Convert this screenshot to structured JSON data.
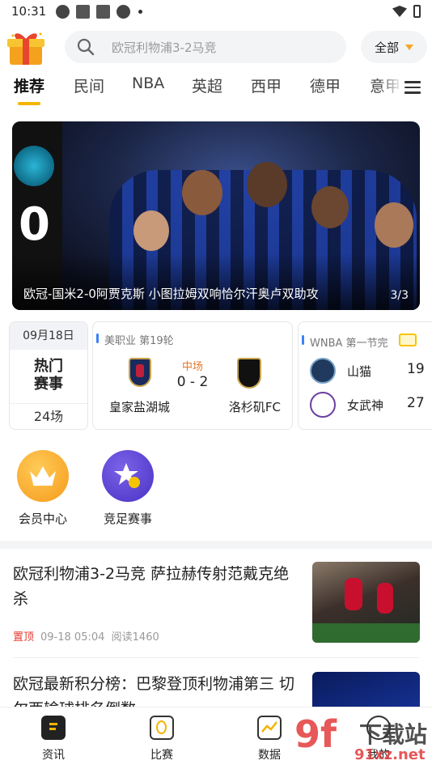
{
  "status_bar": {
    "time": "10:31"
  },
  "header": {
    "search_placeholder": "欧冠利物浦3-2马竞",
    "filter_label": "全部"
  },
  "tabs": [
    "推荐",
    "民间",
    "NBA",
    "英超",
    "西甲",
    "德甲",
    "意甲"
  ],
  "banner": {
    "caption": "欧冠-国米2-0阿贾克斯 小图拉姆双响恰尔汗奥卢双助攻",
    "counter": "3/3",
    "score_fragment": "0"
  },
  "hot_card": {
    "date": "09月18日",
    "line1": "热门",
    "line2": "赛事",
    "count": "24场"
  },
  "match_card": {
    "league": "美职业 第19轮",
    "status": "中场",
    "score": "0 - 2",
    "home": "皇家盐湖城",
    "away": "洛杉矶FC"
  },
  "wnba_card": {
    "league": "WNBA 第一节完",
    "team1": {
      "name": "山猫",
      "score": "19"
    },
    "team2": {
      "name": "女武神",
      "score": "27"
    }
  },
  "quick_links": [
    {
      "label": "会员中心",
      "icon": "crown-icon"
    },
    {
      "label": "竞足赛事",
      "icon": "star-ball-icon"
    }
  ],
  "news": [
    {
      "title": "欧冠利物浦3-2马竞 萨拉赫传射范戴克绝杀",
      "pin": "置顶",
      "time": "09-18 05:04",
      "reads": "阅读1460"
    },
    {
      "title": "欧冠最新积分榜：巴黎登顶利物浦第三 切尔西输球排名倒数"
    }
  ],
  "bottom_nav": [
    "资讯",
    "比赛",
    "数据",
    "我的"
  ],
  "colors": {
    "accent": "#f5b400",
    "pin_red": "#e23b2e",
    "status_orange": "#e5792a"
  },
  "watermark": {
    "mark": "9f",
    "text": "下载站",
    "url": "91xz.net"
  }
}
